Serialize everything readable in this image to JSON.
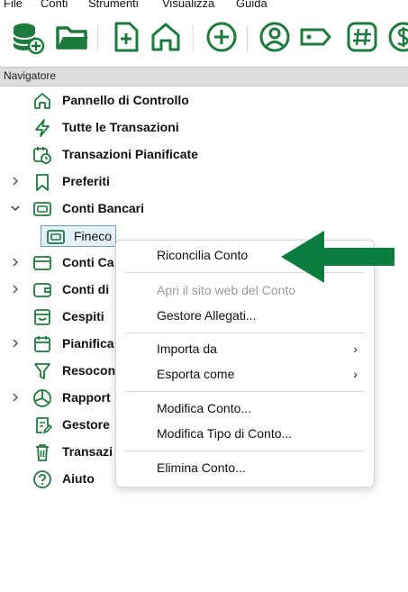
{
  "menubar": {
    "items": [
      "File",
      "Conti",
      "Strumenti",
      "Visualizza",
      "Guida"
    ]
  },
  "toolbar": {
    "icons": [
      "database-add-icon",
      "folder-open-icon",
      "new-file-icon",
      "home-icon",
      "add-circle-icon",
      "user-circle-icon",
      "tag-icon",
      "hash-icon",
      "dollar-icon"
    ],
    "accent": "#1e7a3c"
  },
  "navigator": {
    "title": "Navigatore",
    "items": [
      {
        "label": "Pannello di Controllo"
      },
      {
        "label": "Tutte le Transazioni"
      },
      {
        "label": "Transazioni Pianificate"
      },
      {
        "label": "Preferiti"
      },
      {
        "label": "Conti Bancari"
      },
      {
        "label": "Conti Ca"
      },
      {
        "label": "Conti di"
      },
      {
        "label": "Cespiti"
      },
      {
        "label": "Pianifica"
      },
      {
        "label": "Resocon"
      },
      {
        "label": "Rapport"
      },
      {
        "label": "Gestore"
      },
      {
        "label": "Transazi"
      },
      {
        "label": "Aiuto"
      }
    ],
    "selected_account": "Fineco"
  },
  "context_menu": {
    "items": [
      {
        "label": "Riconcilia Conto"
      },
      {
        "label": "Apri il sito web del Conto"
      },
      {
        "label": "Gestore Allegati..."
      },
      {
        "label": "Importa da"
      },
      {
        "label": "Esporta come"
      },
      {
        "label": "Modifica Conto..."
      },
      {
        "label": "Modifica Tipo di Conto..."
      },
      {
        "label": "Elimina Conto..."
      }
    ]
  },
  "colors": {
    "icon_green": "#1e7a3c",
    "arrow_green": "#0b7d3e",
    "selection_border": "#6b9ec7"
  }
}
